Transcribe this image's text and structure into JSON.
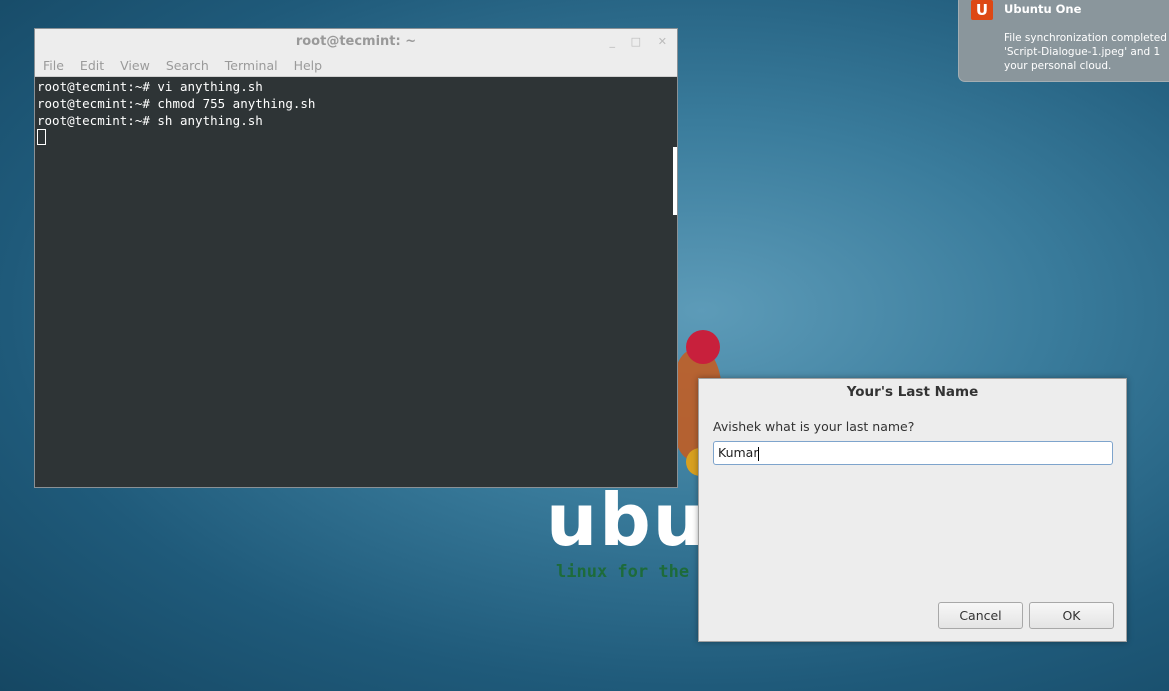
{
  "wallpaper": {
    "word": "ubun",
    "tagline": "linux for the env"
  },
  "terminal": {
    "title": "root@tecmint: ~",
    "menu": [
      "File",
      "Edit",
      "View",
      "Search",
      "Terminal",
      "Help"
    ],
    "lines": [
      "root@tecmint:~# vi anything.sh",
      "root@tecmint:~# chmod 755 anything.sh",
      "root@tecmint:~# sh anything.sh"
    ]
  },
  "notification": {
    "icon": "U",
    "title": "Ubuntu One",
    "body": [
      "File synchronization completed",
      "'Script-Dialogue-1.jpeg' and 1",
      "your personal cloud."
    ]
  },
  "dialog": {
    "title": "Your's Last Name",
    "prompt": "Avishek what is your last name?",
    "value": "Kumar",
    "cancel": "Cancel",
    "ok": "OK"
  }
}
